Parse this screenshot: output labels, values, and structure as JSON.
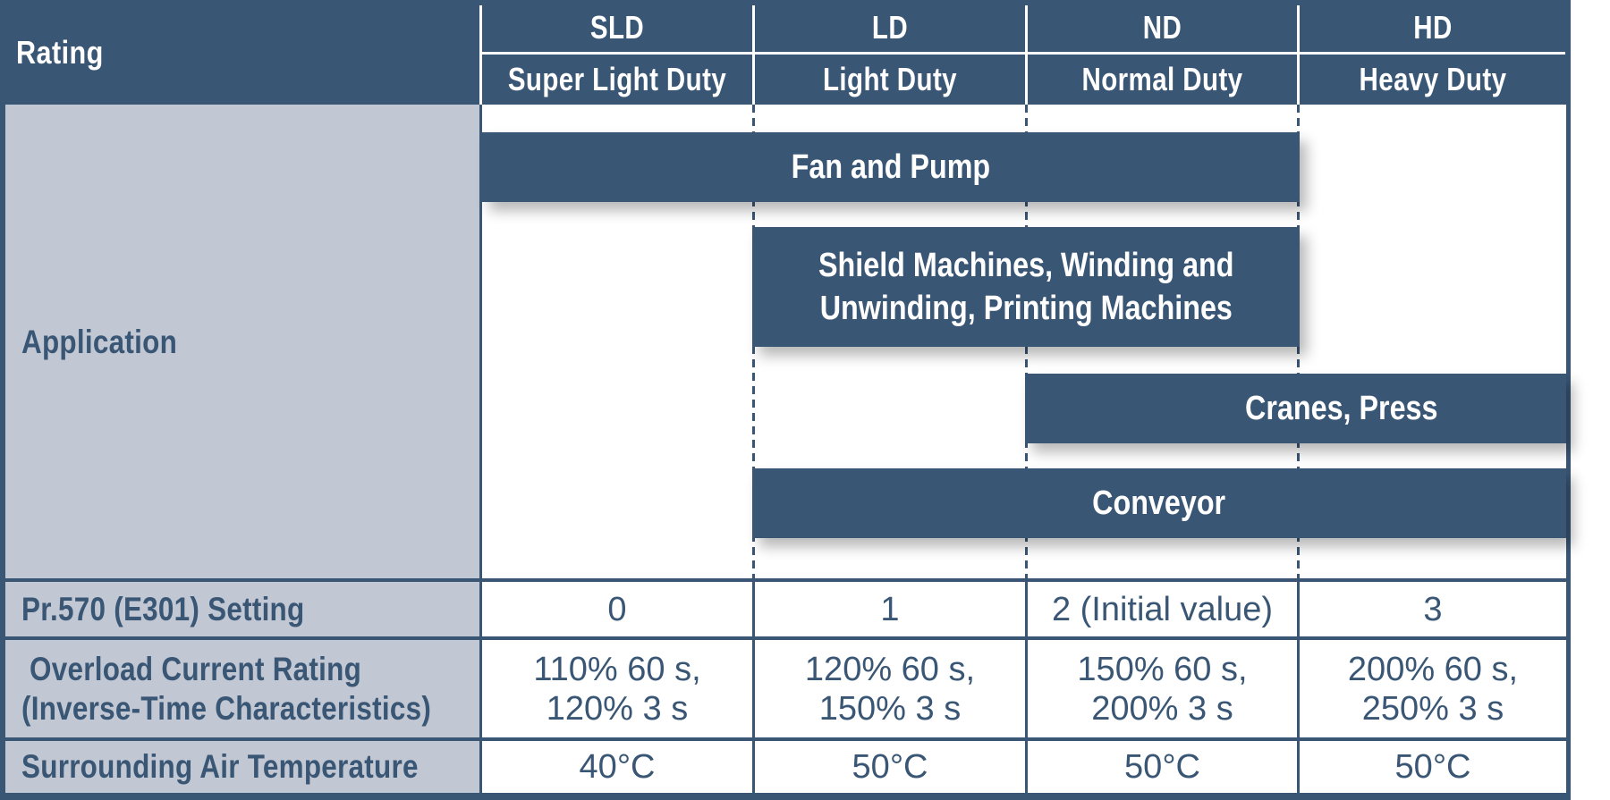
{
  "table": {
    "corner_label": "Rating",
    "columns": [
      {
        "code": "SLD",
        "name": "Super Light Duty"
      },
      {
        "code": "LD",
        "name": "Light Duty"
      },
      {
        "code": "ND",
        "name": "Normal Duty"
      },
      {
        "code": "HD",
        "name": "Heavy Duty"
      }
    ],
    "application": {
      "label": "Application",
      "bars": [
        {
          "lines": [
            "Fan and  Pump"
          ],
          "spans": [
            "SLD",
            "LD",
            "ND"
          ]
        },
        {
          "lines": [
            "Shield Machines, Winding and",
            "Unwinding, Printing Machines"
          ],
          "spans": [
            "LD",
            "ND"
          ]
        },
        {
          "lines": [
            "Cranes, Press"
          ],
          "spans": [
            "ND",
            "HD"
          ]
        },
        {
          "lines": [
            "Conveyor"
          ],
          "spans": [
            "LD",
            "ND",
            "HD"
          ]
        }
      ]
    },
    "rows": [
      {
        "label": [
          "Pr.570 (E301) Setting"
        ],
        "values": [
          [
            "0"
          ],
          [
            "1"
          ],
          [
            "2 (Initial value)"
          ],
          [
            "3"
          ]
        ]
      },
      {
        "label": [
          " Overload Current Rating",
          "(Inverse-Time Characteristics)"
        ],
        "values": [
          [
            "110% 60 s,",
            "120% 3 s"
          ],
          [
            "120% 60 s,",
            "150% 3 s"
          ],
          [
            "150% 60 s,",
            "200% 3 s"
          ],
          [
            "200% 60 s,",
            "250% 3 s"
          ]
        ]
      },
      {
        "label": [
          "Surrounding Air Temperature"
        ],
        "values": [
          [
            "40°C"
          ],
          [
            "50°C"
          ],
          [
            "50°C"
          ],
          [
            "50°C"
          ]
        ]
      }
    ]
  },
  "colors": {
    "navy": "#3a5675",
    "label_bg": "#c1c7d3",
    "white": "#ffffff"
  }
}
